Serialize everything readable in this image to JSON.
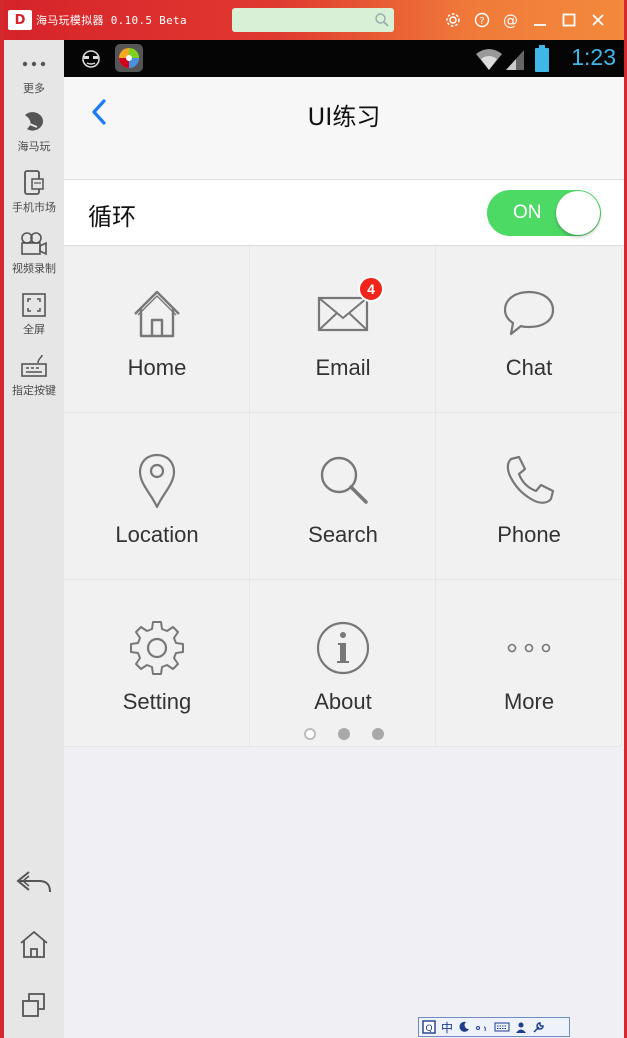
{
  "titlebar": {
    "app_title": "海马玩模拟器 0.10.5 Beta",
    "logo_text": "D",
    "search": {
      "value": "",
      "placeholder": ""
    },
    "buttons": [
      "settings-icon",
      "help-icon",
      "account-icon",
      "minimize-icon",
      "maximize-icon",
      "close-icon"
    ]
  },
  "sidebar": {
    "items": [
      {
        "label": "更多",
        "icon": "more-dots-icon"
      },
      {
        "label": "海马玩",
        "icon": "haimawan-icon"
      },
      {
        "label": "手机市场",
        "icon": "app-market-icon"
      },
      {
        "label": "视频录制",
        "icon": "video-record-icon"
      },
      {
        "label": "全屏",
        "icon": "fullscreen-icon"
      },
      {
        "label": "指定按键",
        "icon": "keymap-icon"
      }
    ],
    "bottom_icons": [
      "back-icon",
      "home-icon",
      "recent-apps-icon"
    ]
  },
  "statusbar": {
    "time": "1:23"
  },
  "navbar": {
    "title": "UI练习",
    "back_icon": "chevron-left-icon"
  },
  "loop": {
    "label": "循环",
    "toggle_text": "ON",
    "toggle_on": true
  },
  "grid": {
    "items": [
      {
        "label": "Home",
        "icon": "house-icon"
      },
      {
        "label": "Email",
        "icon": "envelope-icon",
        "badge": "4"
      },
      {
        "label": "Chat",
        "icon": "speech-bubble-icon"
      },
      {
        "label": "Location",
        "icon": "map-pin-icon"
      },
      {
        "label": "Search",
        "icon": "search-icon"
      },
      {
        "label": "Phone",
        "icon": "phone-icon"
      },
      {
        "label": "Setting",
        "icon": "gear-icon"
      },
      {
        "label": "About",
        "icon": "info-icon"
      },
      {
        "label": "More",
        "icon": "more-dots-icon"
      }
    ]
  },
  "pager": {
    "pages": 3,
    "active": 0
  },
  "ime": {
    "label": "中"
  },
  "colors": {
    "titlebar_red": "#d6232b",
    "titlebar_orange": "#f38a3d",
    "ios_blue": "#1a7cf5",
    "toggle_green": "#4cd964",
    "badge_red": "#f0241b",
    "status_time": "#3fb7e8"
  }
}
